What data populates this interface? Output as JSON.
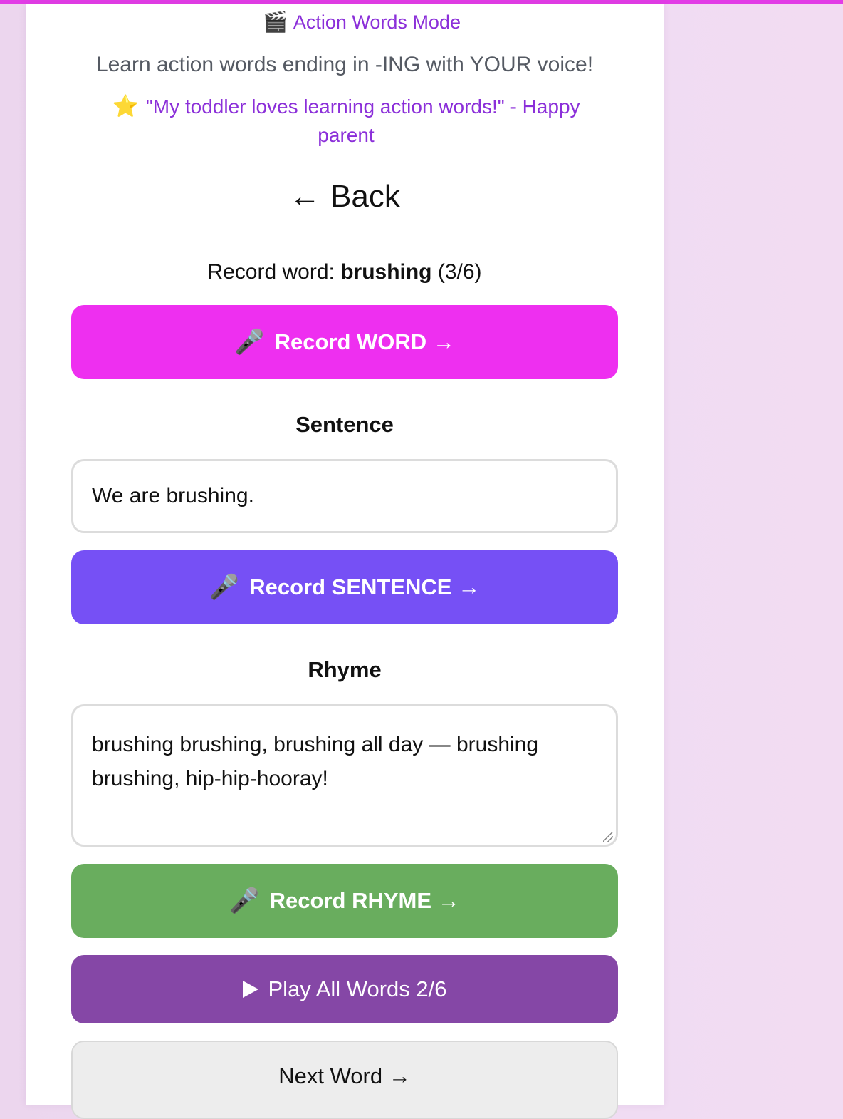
{
  "header": {
    "mode_icon": "clapper-board-icon",
    "mode_title": "Action Words Mode",
    "subtitle": "Learn action words ending in -ING with YOUR voice!",
    "testimonial_icon": "star-icon",
    "testimonial": "\"My toddler loves learning action words!\" - Happy parent"
  },
  "nav": {
    "back_arrow": "←",
    "back_label": "Back"
  },
  "record_word": {
    "prefix": "Record word:",
    "word": "brushing",
    "progress": "(3/6)",
    "button_icon": "microphone-icon",
    "button_label": "Record WORD →"
  },
  "sentence": {
    "label": "Sentence",
    "value": "We are brushing.",
    "button_icon": "microphone-icon",
    "button_label": "Record SENTENCE →"
  },
  "rhyme": {
    "label": "Rhyme",
    "value": "brushing brushing, brushing all day — brushing brushing, hip-hip-hooray!",
    "button_icon": "microphone-icon",
    "button_label": "Record RHYME →"
  },
  "playback": {
    "play_icon": "play-icon",
    "label": "Play All Words 2/6"
  },
  "next": {
    "label": "Next Word →"
  },
  "colors": {
    "accent_magenta": "#ee2ff0",
    "accent_indigo": "#7650f5",
    "accent_green": "#69ad5e",
    "accent_purple": "#8547a6",
    "link_purple": "#8b2fd9"
  }
}
